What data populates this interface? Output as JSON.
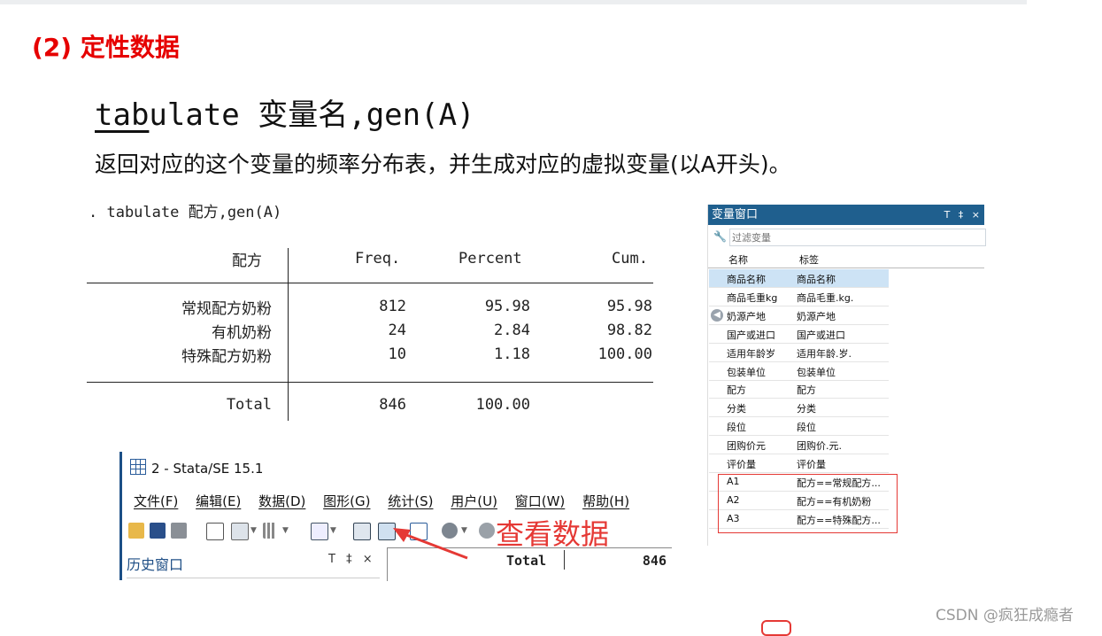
{
  "heading": "(2) 定性数据",
  "command": {
    "underlined": "tab",
    "rest": "ulate 变量名,gen(A)"
  },
  "description": "返回对应的这个变量的频率分布表，并生成对应的虚拟变量(以A开头)。",
  "stata_output": {
    "command_line": ". tabulate 配方,gen(A)",
    "columns": [
      "配方",
      "Freq.",
      "Percent",
      "Cum."
    ],
    "rows": [
      {
        "label": "常规配方奶粉",
        "freq": "812",
        "percent": "95.98",
        "cum": "95.98"
      },
      {
        "label": "有机奶粉",
        "freq": "24",
        "percent": "2.84",
        "cum": "98.82"
      },
      {
        "label": "特殊配方奶粉",
        "freq": "10",
        "percent": "1.18",
        "cum": "100.00"
      }
    ],
    "total": {
      "label": "Total",
      "freq": "846",
      "percent": "100.00"
    }
  },
  "variable_window": {
    "title": "变量窗口",
    "controls": "T ‡ ×",
    "filter_placeholder": "过滤变量",
    "col_name": "名称",
    "col_label": "标签",
    "variables": [
      {
        "name": "商品名称",
        "label": "商品名称"
      },
      {
        "name": "商品毛重kg",
        "label": "商品毛重.kg."
      },
      {
        "name": "奶源产地",
        "label": "奶源产地"
      },
      {
        "name": "国产或进口",
        "label": "国产或进口"
      },
      {
        "name": "适用年龄岁",
        "label": "适用年龄.岁."
      },
      {
        "name": "包装单位",
        "label": "包装单位"
      },
      {
        "name": "配方",
        "label": "配方"
      },
      {
        "name": "分类",
        "label": "分类"
      },
      {
        "name": "段位",
        "label": "段位"
      },
      {
        "name": "团购价元",
        "label": "团购价.元."
      },
      {
        "name": "评价量",
        "label": "评价量"
      },
      {
        "name": "A1",
        "label": "配方==常规配方..."
      },
      {
        "name": "A2",
        "label": "配方==有机奶粉"
      },
      {
        "name": "A3",
        "label": "配方==特殊配方..."
      }
    ]
  },
  "stata_window": {
    "title": "2 - Stata/SE 15.1",
    "menu": [
      "文件(F)",
      "编辑(E)",
      "数据(D)",
      "图形(G)",
      "统计(S)",
      "用户(U)",
      "窗口(W)",
      "帮助(H)"
    ],
    "history_title": "历史窗口",
    "history_controls": "T ‡ ×",
    "output_total": "Total",
    "output_value": "846"
  },
  "annotation": "查看数据",
  "watermark": "CSDN @疯狂成瘾者"
}
